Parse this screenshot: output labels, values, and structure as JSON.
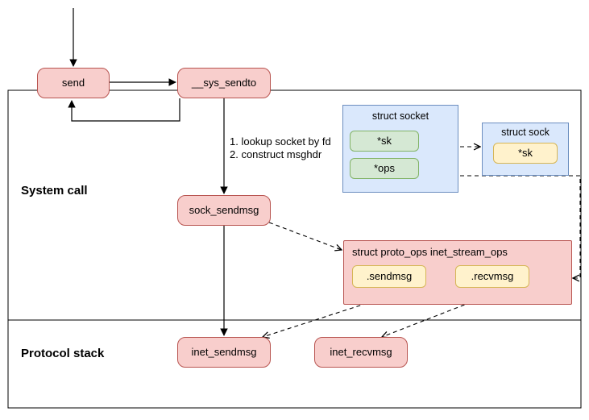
{
  "sections": {
    "system_call": "System call",
    "protocol_stack": "Protocol stack"
  },
  "nodes": {
    "send": "send",
    "sys_sendto": "__sys_sendto",
    "sock_sendmsg": "sock_sendmsg",
    "inet_sendmsg": "inet_sendmsg",
    "inet_recvmsg": "inet_recvmsg"
  },
  "struct_socket": {
    "title": "struct socket",
    "sk": "*sk",
    "ops": "*ops"
  },
  "struct_sock": {
    "title": "struct sock",
    "sk": "*sk"
  },
  "proto_ops": {
    "title": "struct proto_ops inet_stream_ops",
    "sendmsg": ".sendmsg",
    "recvmsg": ".recvmsg"
  },
  "annotations": {
    "lookup_line1": "1. lookup socket by fd",
    "lookup_line2": "2. construct msghdr"
  }
}
